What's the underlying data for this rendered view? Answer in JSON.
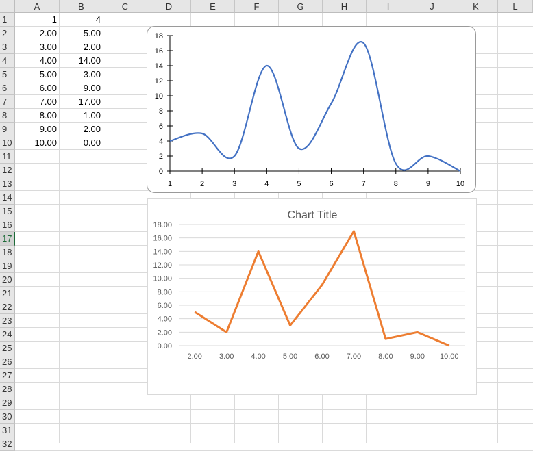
{
  "columns": [
    "A",
    "B",
    "C",
    "D",
    "E",
    "F",
    "G",
    "H",
    "I",
    "J",
    "K",
    "L"
  ],
  "rows": [
    "1",
    "2",
    "3",
    "4",
    "5",
    "6",
    "7",
    "8",
    "9",
    "10",
    "11",
    "12",
    "13",
    "14",
    "15",
    "16",
    "17",
    "18",
    "19",
    "20",
    "21",
    "22",
    "23",
    "24",
    "25",
    "26",
    "27",
    "28",
    "29",
    "30",
    "31",
    "32"
  ],
  "active_row": "17",
  "cells": {
    "A": [
      "1",
      "2.00",
      "3.00",
      "4.00",
      "5.00",
      "6.00",
      "7.00",
      "8.00",
      "9.00",
      "10.00"
    ],
    "B": [
      "4",
      "5.00",
      "2.00",
      "14.00",
      "3.00",
      "9.00",
      "17.00",
      "1.00",
      "2.00",
      "0.00"
    ]
  },
  "chart_data": [
    {
      "type": "line",
      "smooth": true,
      "title": "",
      "x": [
        1,
        2,
        3,
        4,
        5,
        6,
        7,
        8,
        9,
        10
      ],
      "series": [
        {
          "values": [
            4,
            5,
            2,
            14,
            3,
            9,
            17,
            1,
            2,
            0
          ],
          "color": "#4472c4"
        }
      ],
      "x_tick_labels": [
        "1",
        "2",
        "3",
        "4",
        "5",
        "6",
        "7",
        "8",
        "9",
        "10"
      ],
      "y_tick_labels": [
        "0",
        "2",
        "4",
        "6",
        "8",
        "10",
        "12",
        "14",
        "16",
        "18"
      ],
      "ylim": [
        0,
        18
      ],
      "grid": false
    },
    {
      "type": "line",
      "title": "Chart Title",
      "categories": [
        "2.00",
        "3.00",
        "4.00",
        "5.00",
        "6.00",
        "7.00",
        "8.00",
        "9.00",
        "10.00"
      ],
      "series": [
        {
          "values": [
            5,
            2,
            14,
            3,
            9,
            17,
            1,
            2,
            0
          ],
          "color": "#ed7d31"
        }
      ],
      "y_tick_labels": [
        "0.00",
        "2.00",
        "4.00",
        "6.00",
        "8.00",
        "10.00",
        "12.00",
        "14.00",
        "16.00",
        "18.00"
      ],
      "ylim": [
        0,
        18
      ],
      "grid": true
    }
  ]
}
